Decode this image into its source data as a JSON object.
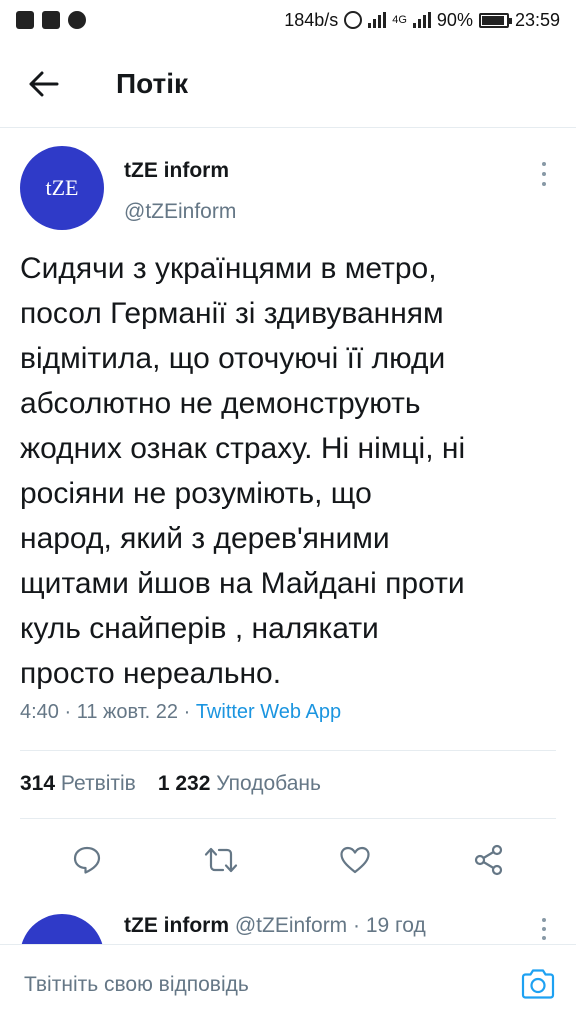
{
  "status_bar": {
    "net_speed": "184b/s",
    "network_label": "4G",
    "battery": "90%",
    "battery_level": 0.9,
    "time": "23:59",
    "icons": [
      "facebook-icon",
      "gallery-icon",
      "viber-icon",
      "alarm-icon",
      "signal-icon",
      "battery-icon"
    ]
  },
  "header": {
    "title": "Потік",
    "back_icon": "arrow-left-icon"
  },
  "tweet": {
    "avatar_text": "tZE",
    "author_name": "tZE inform",
    "author_handle": "@tZEinform",
    "text": "Сидячи з українцями в метро,\nпосол Германії зі здивуванням\nвідмітила, що оточуючі її люди\nабсолютно не демонструють\nжодних ознак страху. Ні німці, ні\nросіяни  не розуміють, що\nнарод, який з дерев'яними\nщитами йшов на Майдані проти\nкуль снайперів , налякати\nпросто нереально.",
    "time": "4:40",
    "date": "11 жовт. 22",
    "source": "Twitter Web App",
    "retweets_count": "314",
    "retweets_label": "Ретвітів",
    "likes_count": "1 232",
    "likes_label": "Уподобань",
    "actions": [
      "reply-icon",
      "retweet-icon",
      "like-icon",
      "share-icon"
    ]
  },
  "reply_preview": {
    "author_name": "tZE inform",
    "author_handle": "@tZEinform",
    "age": "19 год"
  },
  "compose": {
    "placeholder": "Твітніть свою відповідь",
    "camera_icon": "camera-icon"
  },
  "colors": {
    "avatar_bg": "#2f3ac8",
    "link": "#1b95e0",
    "muted": "#657786",
    "text": "#14171a",
    "accent_icon": "#1da1f2"
  }
}
